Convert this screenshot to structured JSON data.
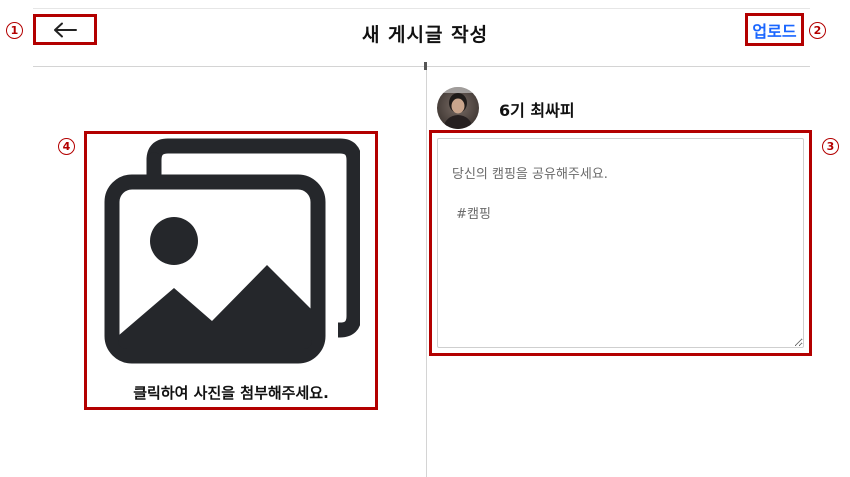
{
  "header": {
    "title": "새 게시글 작성",
    "upload_label": "업로드"
  },
  "user": {
    "name": "6기 최싸피"
  },
  "post": {
    "placeholder": "당신의 캠핑을 공유해주세요.\n\n #캠핑",
    "value": ""
  },
  "photo": {
    "caption": "클릭하여 사진을 첨부해주세요."
  },
  "markers": {
    "m1": "1",
    "m2": "2",
    "m3": "3",
    "m4": "4"
  },
  "colors": {
    "annotation": "#b30000",
    "accent": "#1a66ff",
    "icon": "#25272b"
  }
}
